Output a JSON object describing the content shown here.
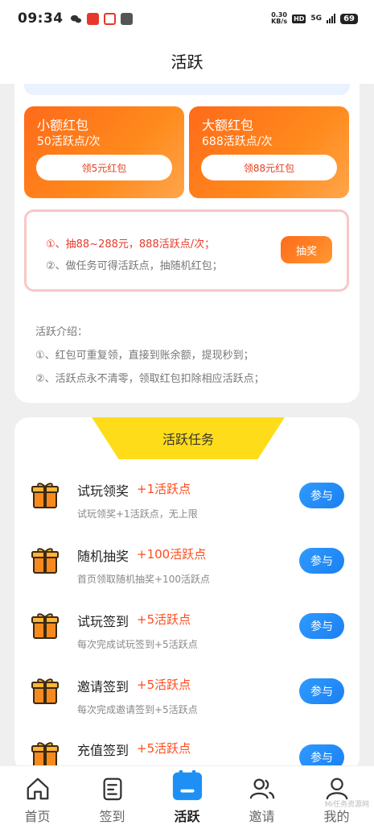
{
  "status": {
    "time": "09:34",
    "netspeed_value": "0.30",
    "netspeed_unit": "KB/s",
    "hd": "HD",
    "network": "5G",
    "battery": "69"
  },
  "header": {
    "title": "活跃"
  },
  "red_packets": [
    {
      "title": "小额红包",
      "sub": "50活跃点/次",
      "button": "领5元红包"
    },
    {
      "title": "大额红包",
      "sub": "688活跃点/次",
      "button": "领88元红包"
    }
  ],
  "lottery": {
    "line1": "①、抽88~288元，888活跃点/次；",
    "line2": "②、做任务可得活跃点，抽随机红包；",
    "button": "抽奖"
  },
  "intro": {
    "title": "活跃介绍：",
    "items": [
      "①、红包可重复领，直接到账余额，提现秒到；",
      "②、活跃点永不清零，领取红包扣除相应活跃点；"
    ]
  },
  "tasks": {
    "header": "活跃任务",
    "items": [
      {
        "name": "试玩领奖",
        "points": "+1活跃点",
        "desc": "试玩领奖+1活跃点，无上限",
        "button": "参与"
      },
      {
        "name": "随机抽奖",
        "points": "+100活跃点",
        "desc": "首页领取随机抽奖+100活跃点",
        "button": "参与"
      },
      {
        "name": "试玩签到",
        "points": "+5活跃点",
        "desc": "每次完成试玩签到+5活跃点",
        "button": "参与"
      },
      {
        "name": "邀请签到",
        "points": "+5活跃点",
        "desc": "每次完成邀请签到+5活跃点",
        "button": "参与"
      },
      {
        "name": "充值签到",
        "points": "+5活跃点",
        "desc": "",
        "button": "参与"
      }
    ]
  },
  "tabbar": {
    "items": [
      {
        "label": "首页",
        "icon": "home-icon"
      },
      {
        "label": "签到",
        "icon": "checkin-icon"
      },
      {
        "label": "活跃",
        "icon": "active-icon",
        "active": true
      },
      {
        "label": "邀请",
        "icon": "invite-icon"
      },
      {
        "label": "我的",
        "icon": "profile-icon"
      }
    ]
  },
  "watermark": "Mi任务资源网"
}
